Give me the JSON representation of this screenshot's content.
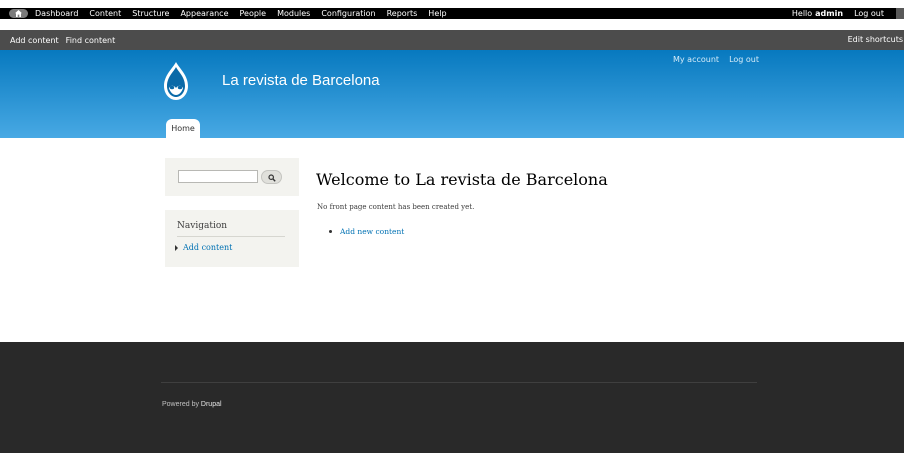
{
  "toolbar": {
    "menu": [
      "Dashboard",
      "Content",
      "Structure",
      "Appearance",
      "People",
      "Modules",
      "Configuration",
      "Reports",
      "Help"
    ],
    "hello": "Hello",
    "user": "admin",
    "logout": "Log out"
  },
  "shortcuts": {
    "items": [
      "Add content",
      "Find content"
    ],
    "edit": "Edit shortcuts"
  },
  "header": {
    "site_name": "La revista de Barcelona",
    "secondary_menu": [
      "My account",
      "Log out"
    ],
    "tab_home": "Home"
  },
  "sidebar": {
    "nav_title": "Navigation",
    "nav_item": "Add content"
  },
  "main": {
    "title": "Welcome to La revista de Barcelona",
    "text": "No front page content has been created yet.",
    "add_link": "Add new content"
  },
  "footer": {
    "powered_by": "Powered by",
    "drupal": "Drupal"
  },
  "colors": {
    "toolbar": "#000000",
    "shortcuts": "#4c4c4c",
    "header_top": "#0779bf",
    "header_bottom": "#48a9e4",
    "link": "#0071b3",
    "footer": "#292929"
  }
}
